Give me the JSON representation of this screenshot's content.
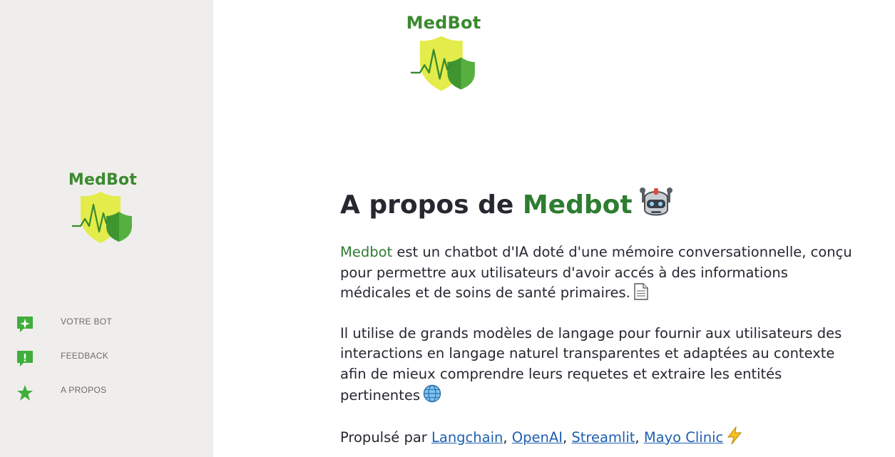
{
  "brand": {
    "name": "MedBot",
    "colors": {
      "green": "#3a8a2e",
      "shield_yellow": "#e3ec4a",
      "shield_green": "#55b040",
      "sidebar_bg": "#f0eeec"
    }
  },
  "sidebar": {
    "items": [
      {
        "label": "VOTRE BOT",
        "icon": "chat-sparkle-icon"
      },
      {
        "label": "FEEDBACK",
        "icon": "feedback-icon"
      },
      {
        "label": "A PROPOS",
        "icon": "star-icon"
      }
    ]
  },
  "main": {
    "title_prefix": "A propos de ",
    "title_highlight": "Medbot",
    "title_icon": "robot-icon",
    "p1_highlight": "Medbot",
    "p1_text": " est un chatbot d'IA doté d'une mémoire conversationnelle, conçu pour permettre aux utilisateurs d'avoir accés à des informations médicales et de soins de santé primaires.",
    "p1_icon": "document-icon",
    "p2_text": "Il utilise de grands modèles de langage pour fournir aux utilisateurs des interactions en langage naturel transparentes et adaptées au contexte afin de mieux comprendre leurs requetes et extraire les entités pertinentes",
    "p2_icon": "globe-icon",
    "p3_prefix": "Propulsé par ",
    "links": [
      "Langchain",
      "OpenAI",
      "Streamlit",
      "Mayo Clinic"
    ],
    "separator": ", ",
    "p3_icon": "lightning-icon"
  }
}
